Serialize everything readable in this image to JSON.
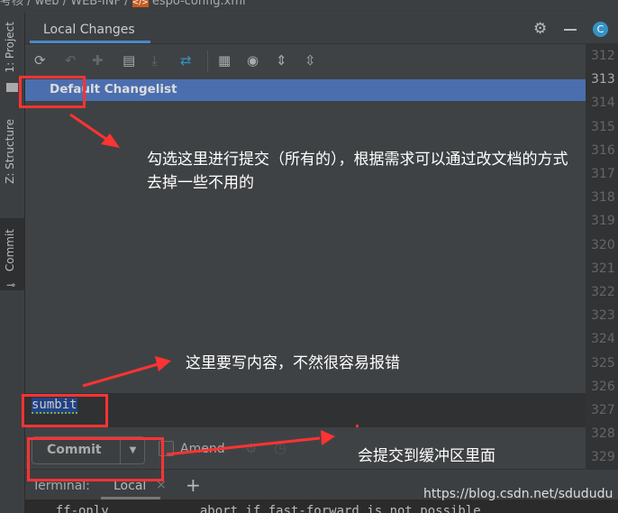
{
  "breadcrumb": {
    "items": [
      "考核",
      "web",
      "WEB-INF",
      "espo-config.xml"
    ]
  },
  "left_tabs": [
    {
      "label": "1: Project"
    },
    {
      "label": "Z: Structure"
    },
    {
      "label": "Commit"
    }
  ],
  "panel": {
    "tab": "Local Changes",
    "changelist": "Default Changelist"
  },
  "toolbar": {
    "icons": [
      "refresh-icon",
      "rollback-icon",
      "diff-icon",
      "shelf-icon",
      "update-icon",
      "merge-icon",
      "group-icon",
      "view-options-icon",
      "expand-all-icon",
      "collapse-all-icon"
    ]
  },
  "commit": {
    "message": "sumbit",
    "button": "Commit",
    "amend": "Amend",
    "amend_checked": false
  },
  "terminal": {
    "label": "Terminal:",
    "tab": "Local",
    "output": "    ff-only            abort if fast-forward is not possible"
  },
  "editor": {
    "tab_icon": "C",
    "lines": [
      "312",
      "313",
      "314",
      "315",
      "316",
      "317",
      "318",
      "319",
      "320",
      "321",
      "322",
      "323",
      "324",
      "325",
      "326",
      "327",
      "328",
      "329"
    ],
    "current": "313"
  },
  "annotations": {
    "a1": "勾选这里进行提交（所有的），根据需求可以通过改文档的方式去掉一些不用的",
    "a2": "这里要写内容，不然很容易报错",
    "a3": "会提交到缓冲区里面",
    "watermark": "https://blog.csdn.net/sdududu"
  },
  "colors": {
    "selection": "#4b6eaf",
    "annotation": "#ff3333",
    "accent": "#4a88c7"
  }
}
